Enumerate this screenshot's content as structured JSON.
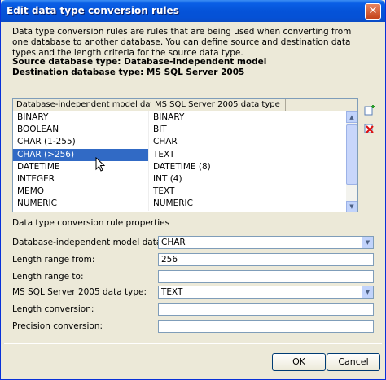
{
  "window": {
    "title": "Edit data type conversion rules",
    "close_label": "✕"
  },
  "description": "Data type conversion rules are rules that are being used when converting from one database to another database. You can define source and destination data types and the length criteria for the source data type.",
  "source_db": "Source database type: Database-independent model",
  "destination_db": "Destination database type: MS SQL Server 2005",
  "grid": {
    "headers": [
      "Database-independent model data type",
      "MS SQL Server 2005 data type"
    ],
    "rows": [
      [
        "BINARY",
        "BINARY"
      ],
      [
        "BOOLEAN",
        "BIT"
      ],
      [
        "CHAR (1-255)",
        "CHAR"
      ],
      [
        "CHAR (>256)",
        "TEXT"
      ],
      [
        "DATETIME",
        "DATETIME (8)"
      ],
      [
        "INTEGER",
        "INT (4)"
      ],
      [
        "MEMO",
        "TEXT"
      ],
      [
        "NUMERIC",
        "NUMERIC"
      ]
    ],
    "selected_row": 3
  },
  "icons": {
    "add": "add-rule-icon",
    "delete": "delete-rule-icon"
  },
  "properties": {
    "section_label": "Data type conversion rule properties",
    "source_type_label": "Database-independent model data type:",
    "source_type_value": "CHAR",
    "length_from_label": "Length range from:",
    "length_from_value": "256",
    "length_to_label": "Length range to:",
    "length_to_value": "",
    "dest_type_label": "MS SQL Server 2005 data type:",
    "dest_type_value": "TEXT",
    "length_conversion_label": "Length conversion:",
    "length_conversion_value": "",
    "precision_conversion_label": "Precision conversion:",
    "precision_conversion_value": ""
  },
  "buttons": {
    "ok": "OK",
    "cancel": "Cancel"
  }
}
